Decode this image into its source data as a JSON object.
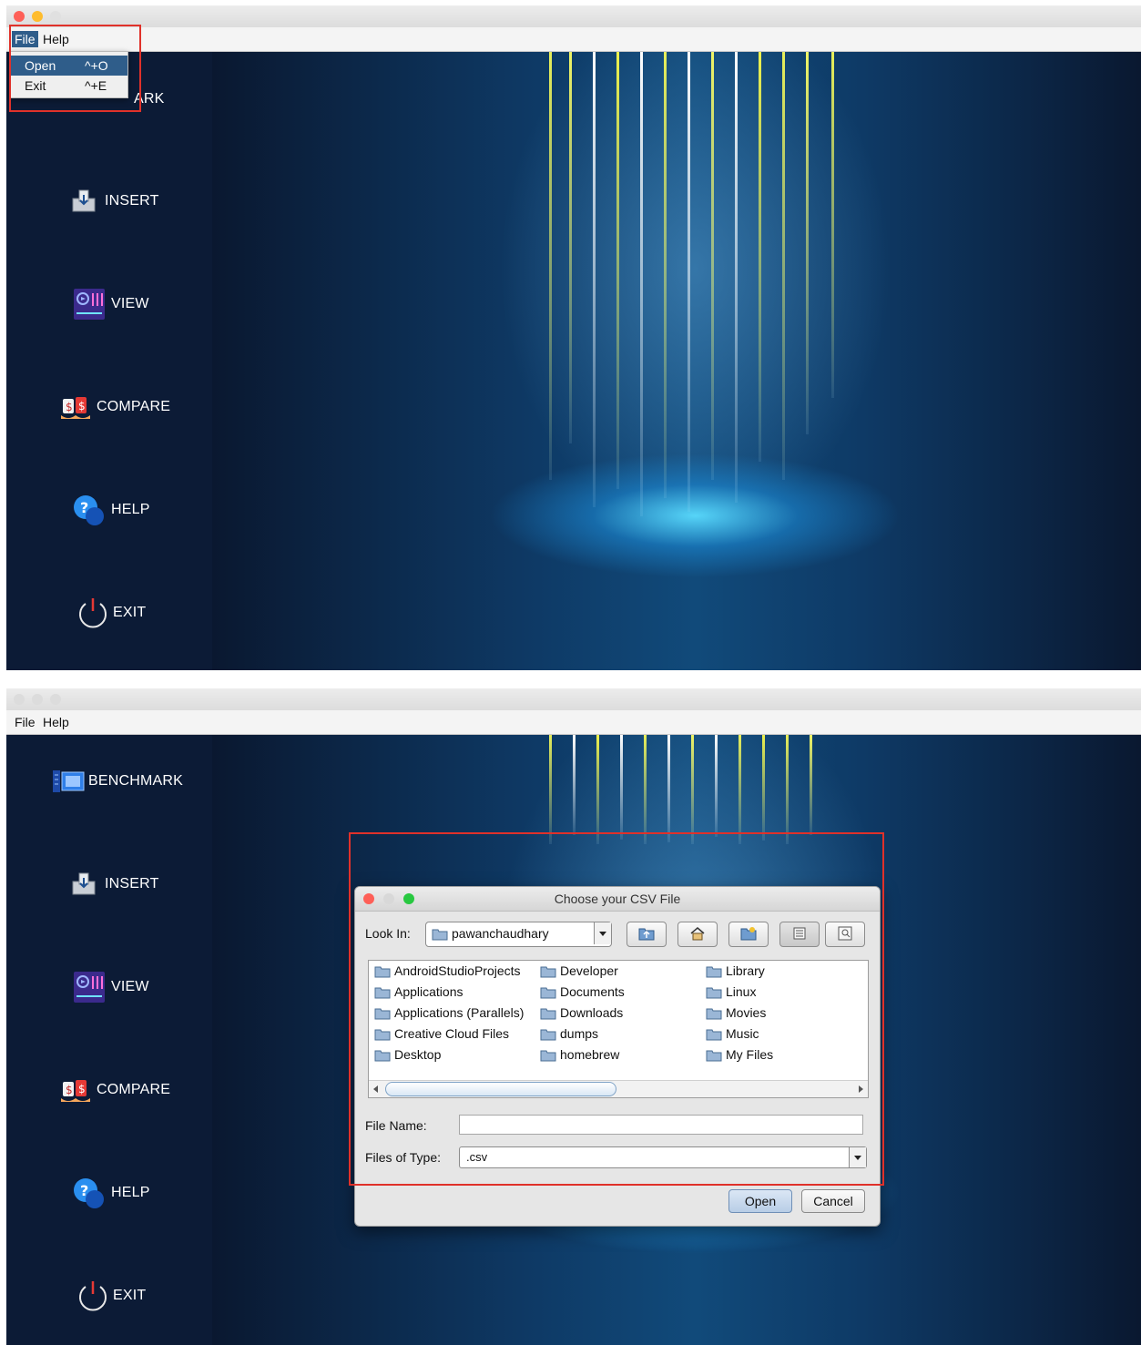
{
  "app": {
    "menus": [
      "File",
      "Help"
    ],
    "nav": {
      "benchmark": "BENCHMARK",
      "benchmark_partial": "ARK",
      "insert": "INSERT",
      "view": "VIEW",
      "compare": "COMPARE",
      "help": "HELP",
      "exit": "EXIT"
    }
  },
  "file_menu": {
    "items": [
      {
        "label": "Open",
        "shortcut": "^+O"
      },
      {
        "label": "Exit",
        "shortcut": "^+E"
      }
    ]
  },
  "dialog": {
    "title": "Choose your CSV File",
    "look_in_label": "Look In:",
    "look_in_value": "pawanchaudhary",
    "files": [
      "AndroidStudioProjects",
      "Applications",
      "Applications (Parallels)",
      "Creative Cloud Files",
      "Desktop",
      "Developer",
      "Documents",
      "Downloads",
      "dumps",
      "homebrew",
      "Library",
      "Linux",
      "Movies",
      "Music",
      "My Files"
    ],
    "file_name_label": "File Name:",
    "file_name_value": "",
    "files_of_type_label": "Files of Type:",
    "files_of_type_value": ".csv",
    "open_label": "Open",
    "cancel_label": "Cancel"
  },
  "colors": {
    "sidebar_bg": "#0c1b36",
    "menu_highlight": "#2f5d8a",
    "annotation_red": "#e0312a",
    "traffic_red": "#fe5f57",
    "traffic_yellow": "#febc2e",
    "traffic_green": "#28c840"
  },
  "icons": [
    "benchmark-icon",
    "insert-icon",
    "view-icon",
    "compare-icon",
    "help-icon",
    "power-icon",
    "folder-icon",
    "up-folder-icon",
    "home-icon",
    "new-folder-icon",
    "list-view-icon",
    "details-view-icon"
  ]
}
